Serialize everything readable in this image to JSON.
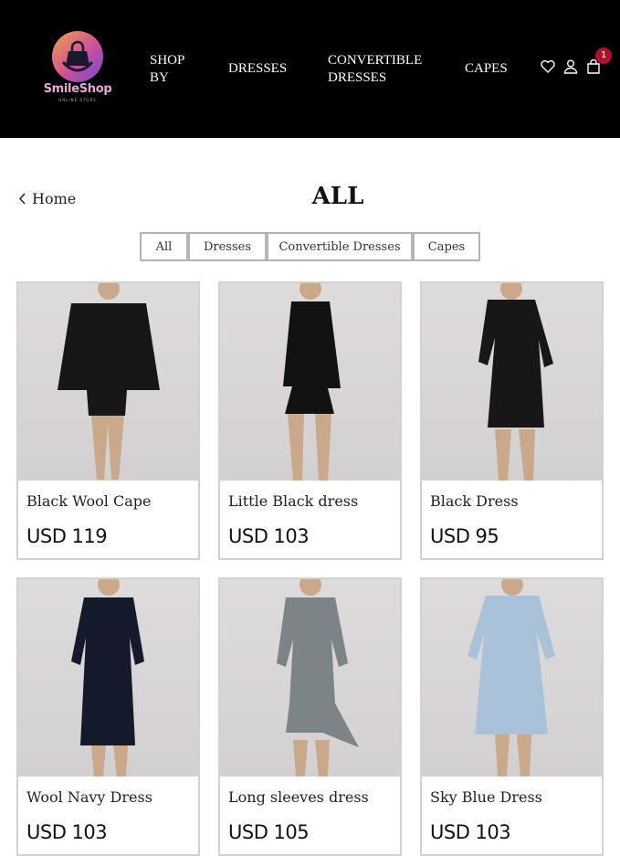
{
  "header": {
    "logo_text": "SmileShop",
    "logo_sub": "ONLINE STORE",
    "nav": [
      "SHOP BY",
      "DRESSES",
      "CONVERTIBLE DRESSES",
      "CAPES"
    ],
    "cart_count": "1"
  },
  "breadcrumb": {
    "back_label": "Home"
  },
  "page_title": "ALL",
  "filters": [
    "All",
    "Dresses",
    "Convertible Dresses",
    "Capes"
  ],
  "products": [
    {
      "name": "Black Wool Cape",
      "price": "USD 119",
      "color": "#161616"
    },
    {
      "name": "Little Black dress",
      "price": "USD 103",
      "color": "#121212"
    },
    {
      "name": "Black Dress",
      "price": "USD 95",
      "color": "#171717"
    },
    {
      "name": "Wool Navy Dress",
      "price": "USD 103",
      "color": "#141a2c"
    },
    {
      "name": "Long sleeves dress",
      "price": "USD 105",
      "color": "#7d8488"
    },
    {
      "name": "Sky Blue Dress",
      "price": "USD 103",
      "color": "#a9c2d9"
    }
  ],
  "icons": [
    "heart-icon",
    "user-icon",
    "bag-icon",
    "chevron-left-icon"
  ]
}
